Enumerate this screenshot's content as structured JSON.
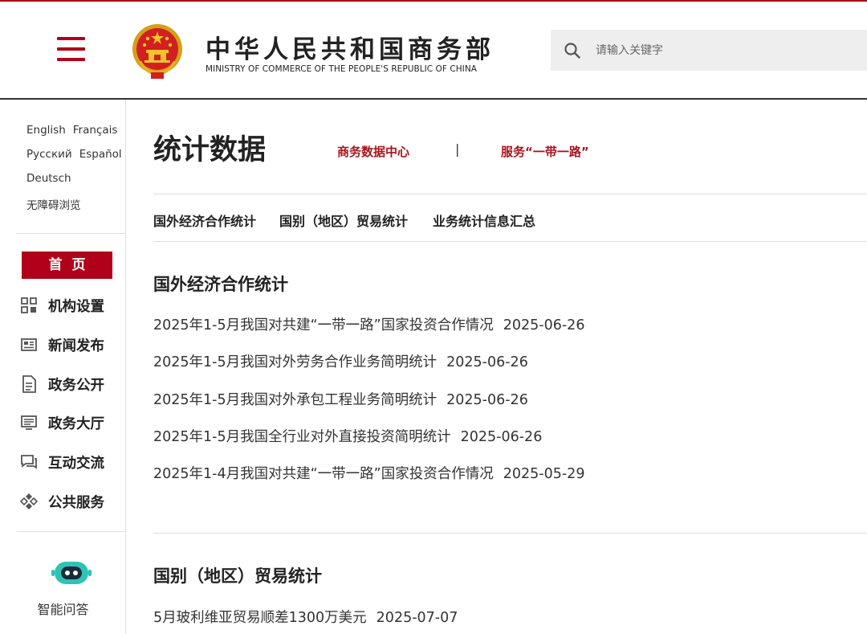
{
  "header": {
    "site_title_cn": "中华人民共和国商务部",
    "site_title_en": "MINISTRY OF COMMERCE OF THE PEOPLE'S REPUBLIC OF CHINA",
    "search_placeholder": "请输入关键字",
    "brand_color": "#b0001a"
  },
  "sidebar": {
    "languages_row1": [
      "English",
      "Français"
    ],
    "languages_row2": [
      "Русский",
      "Español"
    ],
    "languages_row3": [
      "Deutsch"
    ],
    "accessibility": "无障碍浏览",
    "home": "首页",
    "nav": [
      {
        "label": "机构设置",
        "icon": "org-grid-icon"
      },
      {
        "label": "新闻发布",
        "icon": "news-icon"
      },
      {
        "label": "政务公开",
        "icon": "document-icon"
      },
      {
        "label": "政务大厅",
        "icon": "monitor-icon"
      },
      {
        "label": "互动交流",
        "icon": "chat-icon"
      },
      {
        "label": "公共服务",
        "icon": "service-icon"
      }
    ],
    "assistant_label": "智能问答"
  },
  "main": {
    "title": "统计数据",
    "top_links": [
      "商务数据中心",
      "服务“一带一路”"
    ],
    "separator": "|",
    "subnav": [
      "国外经济合作统计",
      "国别（地区）贸易统计",
      "业务统计信息汇总"
    ],
    "sections": [
      {
        "title": "国外经济合作统计",
        "items": [
          {
            "text": "2025年1-5月我国对共建“一带一路”国家投资合作情况",
            "date": "2025-06-26"
          },
          {
            "text": "2025年1-5月我国对外劳务合作业务简明统计",
            "date": "2025-06-26"
          },
          {
            "text": "2025年1-5月我国对外承包工程业务简明统计",
            "date": "2025-06-26"
          },
          {
            "text": "2025年1-5月我国全行业对外直接投资简明统计",
            "date": "2025-06-26"
          },
          {
            "text": "2025年1-4月我国对共建“一带一路”国家投资合作情况",
            "date": "2025-05-29"
          }
        ]
      },
      {
        "title": "国别（地区）贸易统计",
        "items": [
          {
            "text": "5月玻利维亚贸易顺差1300万美元",
            "date": "2025-07-07"
          }
        ]
      }
    ]
  }
}
